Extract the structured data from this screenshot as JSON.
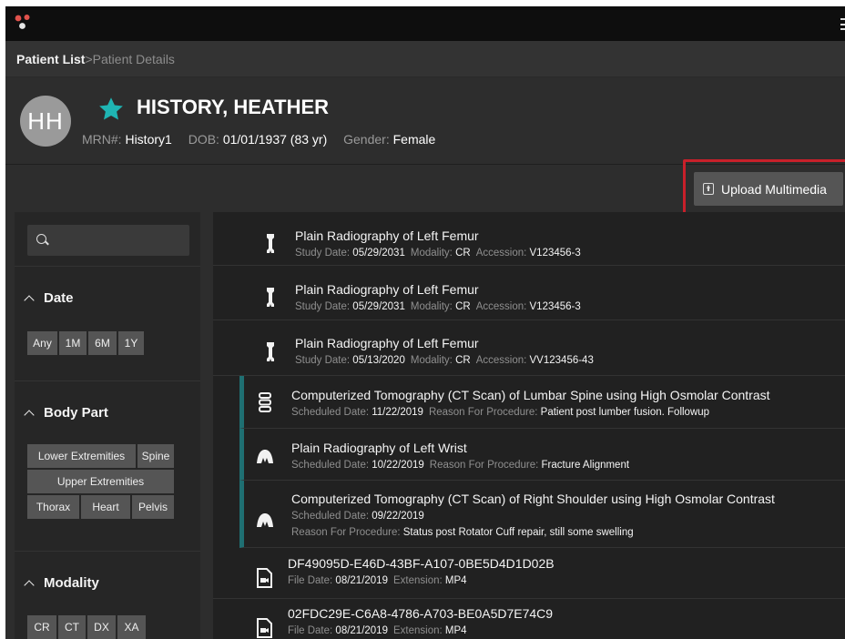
{
  "breadcrumb": {
    "link": "Patient List",
    "separator": ">",
    "current": "Patient Details"
  },
  "patient": {
    "initials": "HH",
    "name": "HISTORY, HEATHER",
    "mrn_label": "MRN#: ",
    "mrn": "History1",
    "dob_label": "DOB: ",
    "dob": "01/01/1937 (83 yr)",
    "gender_label": "Gender: ",
    "gender": "Female",
    "star_color": "#1fb5b3"
  },
  "toolbar": {
    "upload_label": "Upload Multimedia"
  },
  "filters": {
    "search_placeholder": "",
    "date": {
      "title": "Date",
      "options": [
        "Any",
        "1M",
        "6M",
        "1Y"
      ]
    },
    "body_part": {
      "title": "Body Part",
      "options": [
        "Lower Extremities",
        "Spine",
        "Upper Extremities",
        "Thorax",
        "Heart",
        "Pelvis"
      ]
    },
    "modality": {
      "title": "Modality",
      "options": [
        "CR",
        "CT",
        "DX",
        "XA"
      ]
    }
  },
  "items": [
    {
      "icon": "femur-icon",
      "title": "Plain Radiography of Left Femur",
      "l1": "Study Date: ",
      "v1": "05/29/2031",
      "l2": "Modality: ",
      "v2": "CR",
      "l3": "Accession: ",
      "v3": "V123456-3"
    },
    {
      "icon": "femur-icon",
      "title": "Plain Radiography of Left Femur",
      "l1": "Study Date: ",
      "v1": "05/29/2031",
      "l2": "Modality: ",
      "v2": "CR",
      "l3": "Accession: ",
      "v3": "V123456-3"
    },
    {
      "icon": "femur-icon",
      "title": "Plain Radiography of Left Femur",
      "l1": "Study Date: ",
      "v1": "05/13/2020",
      "l2": "Modality: ",
      "v2": "CR",
      "l3": "Accession: ",
      "v3": "VV123456-43"
    },
    {
      "icon": "spine-icon",
      "title": "Computerized Tomography (CT Scan) of Lumbar Spine using High Osmolar Contrast",
      "l1": "Scheduled Date: ",
      "v1": "11/22/2019",
      "l2": "Reason For Procedure: ",
      "v2": "Patient post lumber fusion. Followup"
    },
    {
      "icon": "wrist-icon",
      "title": "Plain Radiography of Left Wrist",
      "l1": "Scheduled Date: ",
      "v1": "10/22/2019",
      "l2": "Reason For Procedure: ",
      "v2": "Fracture Alignment"
    },
    {
      "icon": "shoulder-icon",
      "title": "Computerized Tomography (CT Scan) of Right Shoulder using High Osmolar Contrast",
      "l1": "Scheduled Date: ",
      "v1": "09/22/2019",
      "l2": "Reason For Procedure: ",
      "v2": "Status post Rotator Cuff repair, still some swelling"
    },
    {
      "icon": "video-file-icon",
      "title": "DF49095D-E46D-43BF-A107-0BE5D4D1D02B",
      "l1": "File Date: ",
      "v1": "08/21/2019",
      "l2": "Extension: ",
      "v2": "MP4"
    },
    {
      "icon": "video-file-icon",
      "title": "02FDC29E-C6A8-4786-A703-BE0A5D7E74C9",
      "l1": "File Date: ",
      "v1": "08/21/2019",
      "l2": "Extension: ",
      "v2": "MP4"
    }
  ],
  "colors": {
    "accent_teal": "#1fb5b3",
    "scheduled_bar": "#1f6f72",
    "highlight_red": "#c8202a"
  }
}
